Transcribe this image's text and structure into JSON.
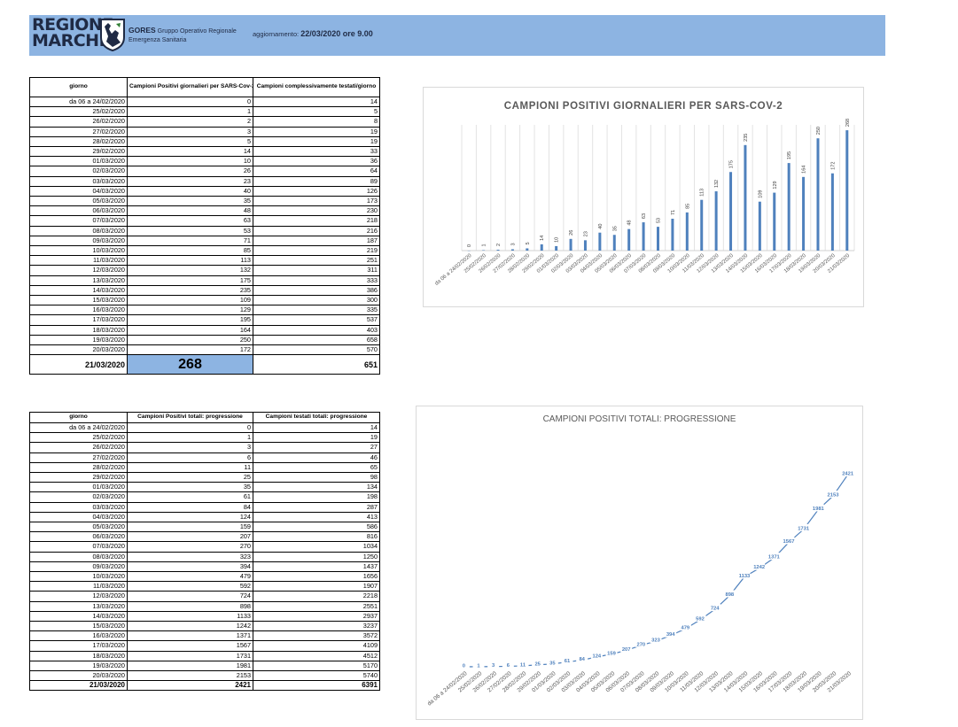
{
  "header": {
    "logo_line1": "REGIONE",
    "logo_line2": "MARCHE",
    "org_name": "GORES",
    "org_line1": "Gruppo Operativo Regionale",
    "org_line2": "Emergenza Sanitaria",
    "update_label": "aggiornamento:",
    "update_value": "22/03/2020 ore 9.00"
  },
  "table1": {
    "headers": [
      "giorno",
      "Campioni Positivi giornalieri per SARS-Cov-2",
      "Campioni complessivamente testati/giorno"
    ],
    "rows": [
      [
        "da 06 a 24/02/2020",
        "0",
        "14"
      ],
      [
        "25/02/2020",
        "1",
        "5"
      ],
      [
        "26/02/2020",
        "2",
        "8"
      ],
      [
        "27/02/2020",
        "3",
        "19"
      ],
      [
        "28/02/2020",
        "5",
        "19"
      ],
      [
        "29/02/2020",
        "14",
        "33"
      ],
      [
        "01/03/2020",
        "10",
        "36"
      ],
      [
        "02/03/2020",
        "26",
        "64"
      ],
      [
        "03/03/2020",
        "23",
        "89"
      ],
      [
        "04/03/2020",
        "40",
        "126"
      ],
      [
        "05/03/2020",
        "35",
        "173"
      ],
      [
        "06/03/2020",
        "48",
        "230"
      ],
      [
        "07/03/2020",
        "63",
        "218"
      ],
      [
        "08/03/2020",
        "53",
        "216"
      ],
      [
        "09/03/2020",
        "71",
        "187"
      ],
      [
        "10/03/2020",
        "85",
        "219"
      ],
      [
        "11/03/2020",
        "113",
        "251"
      ],
      [
        "12/03/2020",
        "132",
        "311"
      ],
      [
        "13/03/2020",
        "175",
        "333"
      ],
      [
        "14/03/2020",
        "235",
        "386"
      ],
      [
        "15/03/2020",
        "109",
        "300"
      ],
      [
        "16/03/2020",
        "129",
        "335"
      ],
      [
        "17/03/2020",
        "195",
        "537"
      ],
      [
        "18/03/2020",
        "164",
        "403"
      ],
      [
        "19/03/2020",
        "250",
        "658"
      ],
      [
        "20/03/2020",
        "172",
        "570"
      ]
    ],
    "total": [
      "21/03/2020",
      "268",
      "651"
    ]
  },
  "table2": {
    "headers": [
      "giorno",
      "Campioni Positivi totali: progressione",
      "Campioni testati totali: progressione"
    ],
    "rows": [
      [
        "da 06 a 24/02/2020",
        "0",
        "14"
      ],
      [
        "25/02/2020",
        "1",
        "19"
      ],
      [
        "26/02/2020",
        "3",
        "27"
      ],
      [
        "27/02/2020",
        "6",
        "46"
      ],
      [
        "28/02/2020",
        "11",
        "65"
      ],
      [
        "29/02/2020",
        "25",
        "98"
      ],
      [
        "01/03/2020",
        "35",
        "134"
      ],
      [
        "02/03/2020",
        "61",
        "198"
      ],
      [
        "03/03/2020",
        "84",
        "287"
      ],
      [
        "04/03/2020",
        "124",
        "413"
      ],
      [
        "05/03/2020",
        "159",
        "586"
      ],
      [
        "06/03/2020",
        "207",
        "816"
      ],
      [
        "07/03/2020",
        "270",
        "1034"
      ],
      [
        "08/03/2020",
        "323",
        "1250"
      ],
      [
        "09/03/2020",
        "394",
        "1437"
      ],
      [
        "10/03/2020",
        "479",
        "1656"
      ],
      [
        "11/03/2020",
        "592",
        "1907"
      ],
      [
        "12/03/2020",
        "724",
        "2218"
      ],
      [
        "13/03/2020",
        "898",
        "2551"
      ],
      [
        "14/03/2020",
        "1133",
        "2937"
      ],
      [
        "15/03/2020",
        "1242",
        "3237"
      ],
      [
        "16/03/2020",
        "1371",
        "3572"
      ],
      [
        "17/03/2020",
        "1567",
        "4109"
      ],
      [
        "18/03/2020",
        "1731",
        "4512"
      ],
      [
        "19/03/2020",
        "1981",
        "5170"
      ],
      [
        "20/03/2020",
        "2153",
        "5740"
      ]
    ],
    "total": [
      "21/03/2020",
      "2421",
      "6391"
    ]
  },
  "chart_data": [
    {
      "type": "bar",
      "title": "CAMPIONI POSITIVI GIORNALIERI PER SARS-COV-2",
      "categories": [
        "da 06 a 24/02/2020",
        "25/02/2020",
        "26/02/2020",
        "27/02/2020",
        "28/02/2020",
        "29/02/2020",
        "01/03/2020",
        "02/03/2020",
        "03/03/2020",
        "04/03/2020",
        "05/03/2020",
        "06/03/2020",
        "07/03/2020",
        "08/03/2020",
        "09/03/2020",
        "10/03/2020",
        "11/03/2020",
        "12/03/2020",
        "13/03/2020",
        "14/03/2020",
        "15/03/2020",
        "16/03/2020",
        "17/03/2020",
        "18/03/2020",
        "19/03/2020",
        "20/03/2020",
        "21/03/2020"
      ],
      "values": [
        0,
        1,
        2,
        3,
        5,
        14,
        10,
        26,
        23,
        40,
        35,
        48,
        63,
        53,
        71,
        85,
        113,
        132,
        175,
        235,
        109,
        129,
        195,
        164,
        250,
        172,
        268
      ],
      "ylim": [
        0,
        280
      ],
      "grid": "vertical",
      "color": "#4f81bd"
    },
    {
      "type": "line",
      "title": "CAMPIONI POSITIVI TOTALI: PROGRESSIONE",
      "categories": [
        "da 06 a 24/02/2020",
        "25/02/2020",
        "26/02/2020",
        "27/02/2020",
        "28/02/2020",
        "29/02/2020",
        "01/03/2020",
        "02/03/2020",
        "03/03/2020",
        "04/03/2020",
        "05/03/2020",
        "06/03/2020",
        "07/03/2020",
        "08/03/2020",
        "09/03/2020",
        "10/03/2020",
        "11/03/2020",
        "12/03/2020",
        "13/03/2020",
        "14/03/2020",
        "15/03/2020",
        "16/03/2020",
        "17/03/2020",
        "18/03/2020",
        "19/03/2020",
        "20/03/2020",
        "21/03/2020"
      ],
      "values": [
        0,
        1,
        3,
        6,
        11,
        25,
        35,
        61,
        84,
        124,
        159,
        207,
        270,
        323,
        394,
        479,
        592,
        724,
        898,
        1133,
        1242,
        1371,
        1567,
        1731,
        1981,
        2153,
        2421
      ],
      "ylim": [
        0,
        2500
      ],
      "grid": "none",
      "color": "#4f81bd"
    }
  ]
}
